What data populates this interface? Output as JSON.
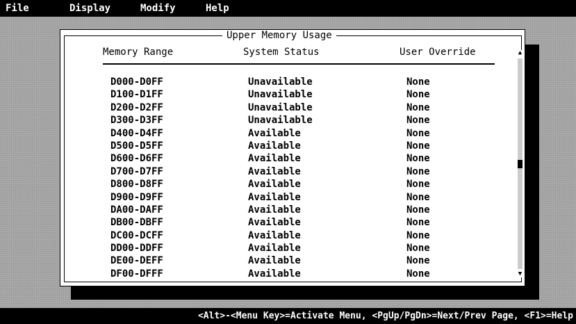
{
  "menu": {
    "items": [
      {
        "label": "File"
      },
      {
        "label": "Display"
      },
      {
        "label": "Modify"
      },
      {
        "label": "Help"
      }
    ]
  },
  "dialog": {
    "title": "Upper Memory Usage",
    "columns": {
      "range": "Memory Range",
      "status": "System Status",
      "override": "User Override"
    },
    "rows": [
      {
        "range": "D000-D0FF",
        "status": "Unavailable",
        "override": "None"
      },
      {
        "range": "D100-D1FF",
        "status": "Unavailable",
        "override": "None"
      },
      {
        "range": "D200-D2FF",
        "status": "Unavailable",
        "override": "None"
      },
      {
        "range": "D300-D3FF",
        "status": "Unavailable",
        "override": "None"
      },
      {
        "range": "D400-D4FF",
        "status": "Available",
        "override": "None"
      },
      {
        "range": "D500-D5FF",
        "status": "Available",
        "override": "None"
      },
      {
        "range": "D600-D6FF",
        "status": "Available",
        "override": "None"
      },
      {
        "range": "D700-D7FF",
        "status": "Available",
        "override": "None"
      },
      {
        "range": "D800-D8FF",
        "status": "Available",
        "override": "None"
      },
      {
        "range": "D900-D9FF",
        "status": "Available",
        "override": "None"
      },
      {
        "range": "DA00-DAFF",
        "status": "Available",
        "override": "None"
      },
      {
        "range": "DB00-DBFF",
        "status": "Available",
        "override": "None"
      },
      {
        "range": "DC00-DCFF",
        "status": "Available",
        "override": "None"
      },
      {
        "range": "DD00-DDFF",
        "status": "Available",
        "override": "None"
      },
      {
        "range": "DE00-DEFF",
        "status": "Available",
        "override": "None"
      },
      {
        "range": "DF00-DFFF",
        "status": "Available",
        "override": "None"
      }
    ],
    "scroll": {
      "up_icon": "scroll-up-arrow",
      "down_icon": "scroll-down-arrow",
      "position_fraction": 0.5
    }
  },
  "statusbar": {
    "text": "<Alt>-<Menu Key>=Activate Menu, <PgUp/PgDn>=Next/Prev Page, <F1>=Help"
  },
  "colors": {
    "menubar_bg": "#000000",
    "menubar_fg": "#ffffff",
    "dialog_bg": "#ffffff",
    "desktop": "#c8c8c8"
  }
}
